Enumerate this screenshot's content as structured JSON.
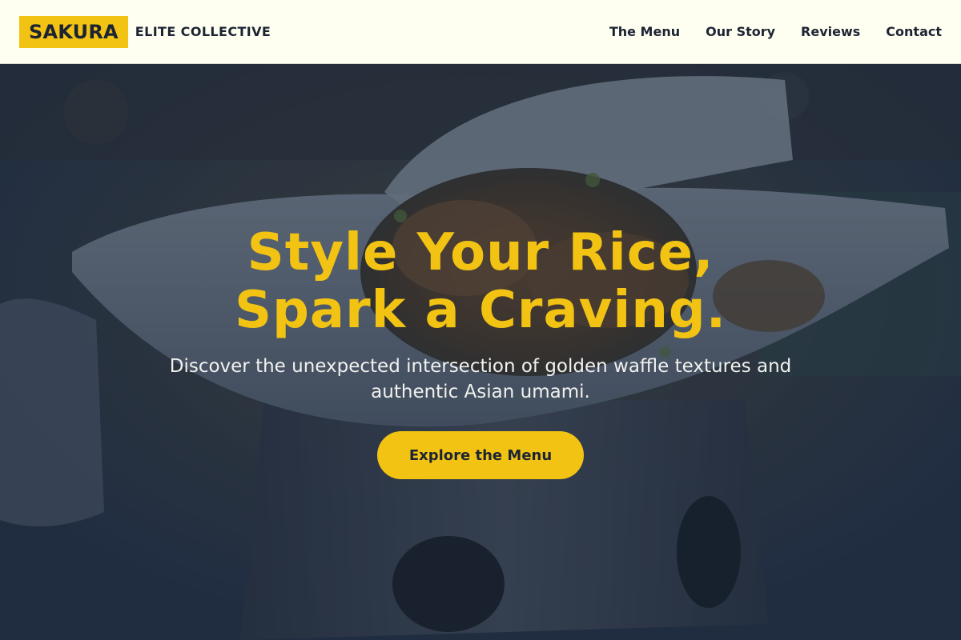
{
  "brand": {
    "name": "SAKURA",
    "tagline": "ELITE COLLECTIVE"
  },
  "nav": {
    "links": [
      {
        "label": "The Menu"
      },
      {
        "label": "Our Story"
      },
      {
        "label": "Reviews"
      },
      {
        "label": "Contact"
      }
    ]
  },
  "hero": {
    "title_line1": "Style Your Rice,",
    "title_line2": "Spark a Craving.",
    "subtitle": "Discover the unexpected intersection of golden waffle textures and authentic Asian umami.",
    "cta_label": "Explore the Menu"
  },
  "colors": {
    "accent": "#f2c313",
    "navbar_bg": "#fffff1",
    "text_dark": "#1c2433",
    "overlay": "#1e2a3c"
  }
}
